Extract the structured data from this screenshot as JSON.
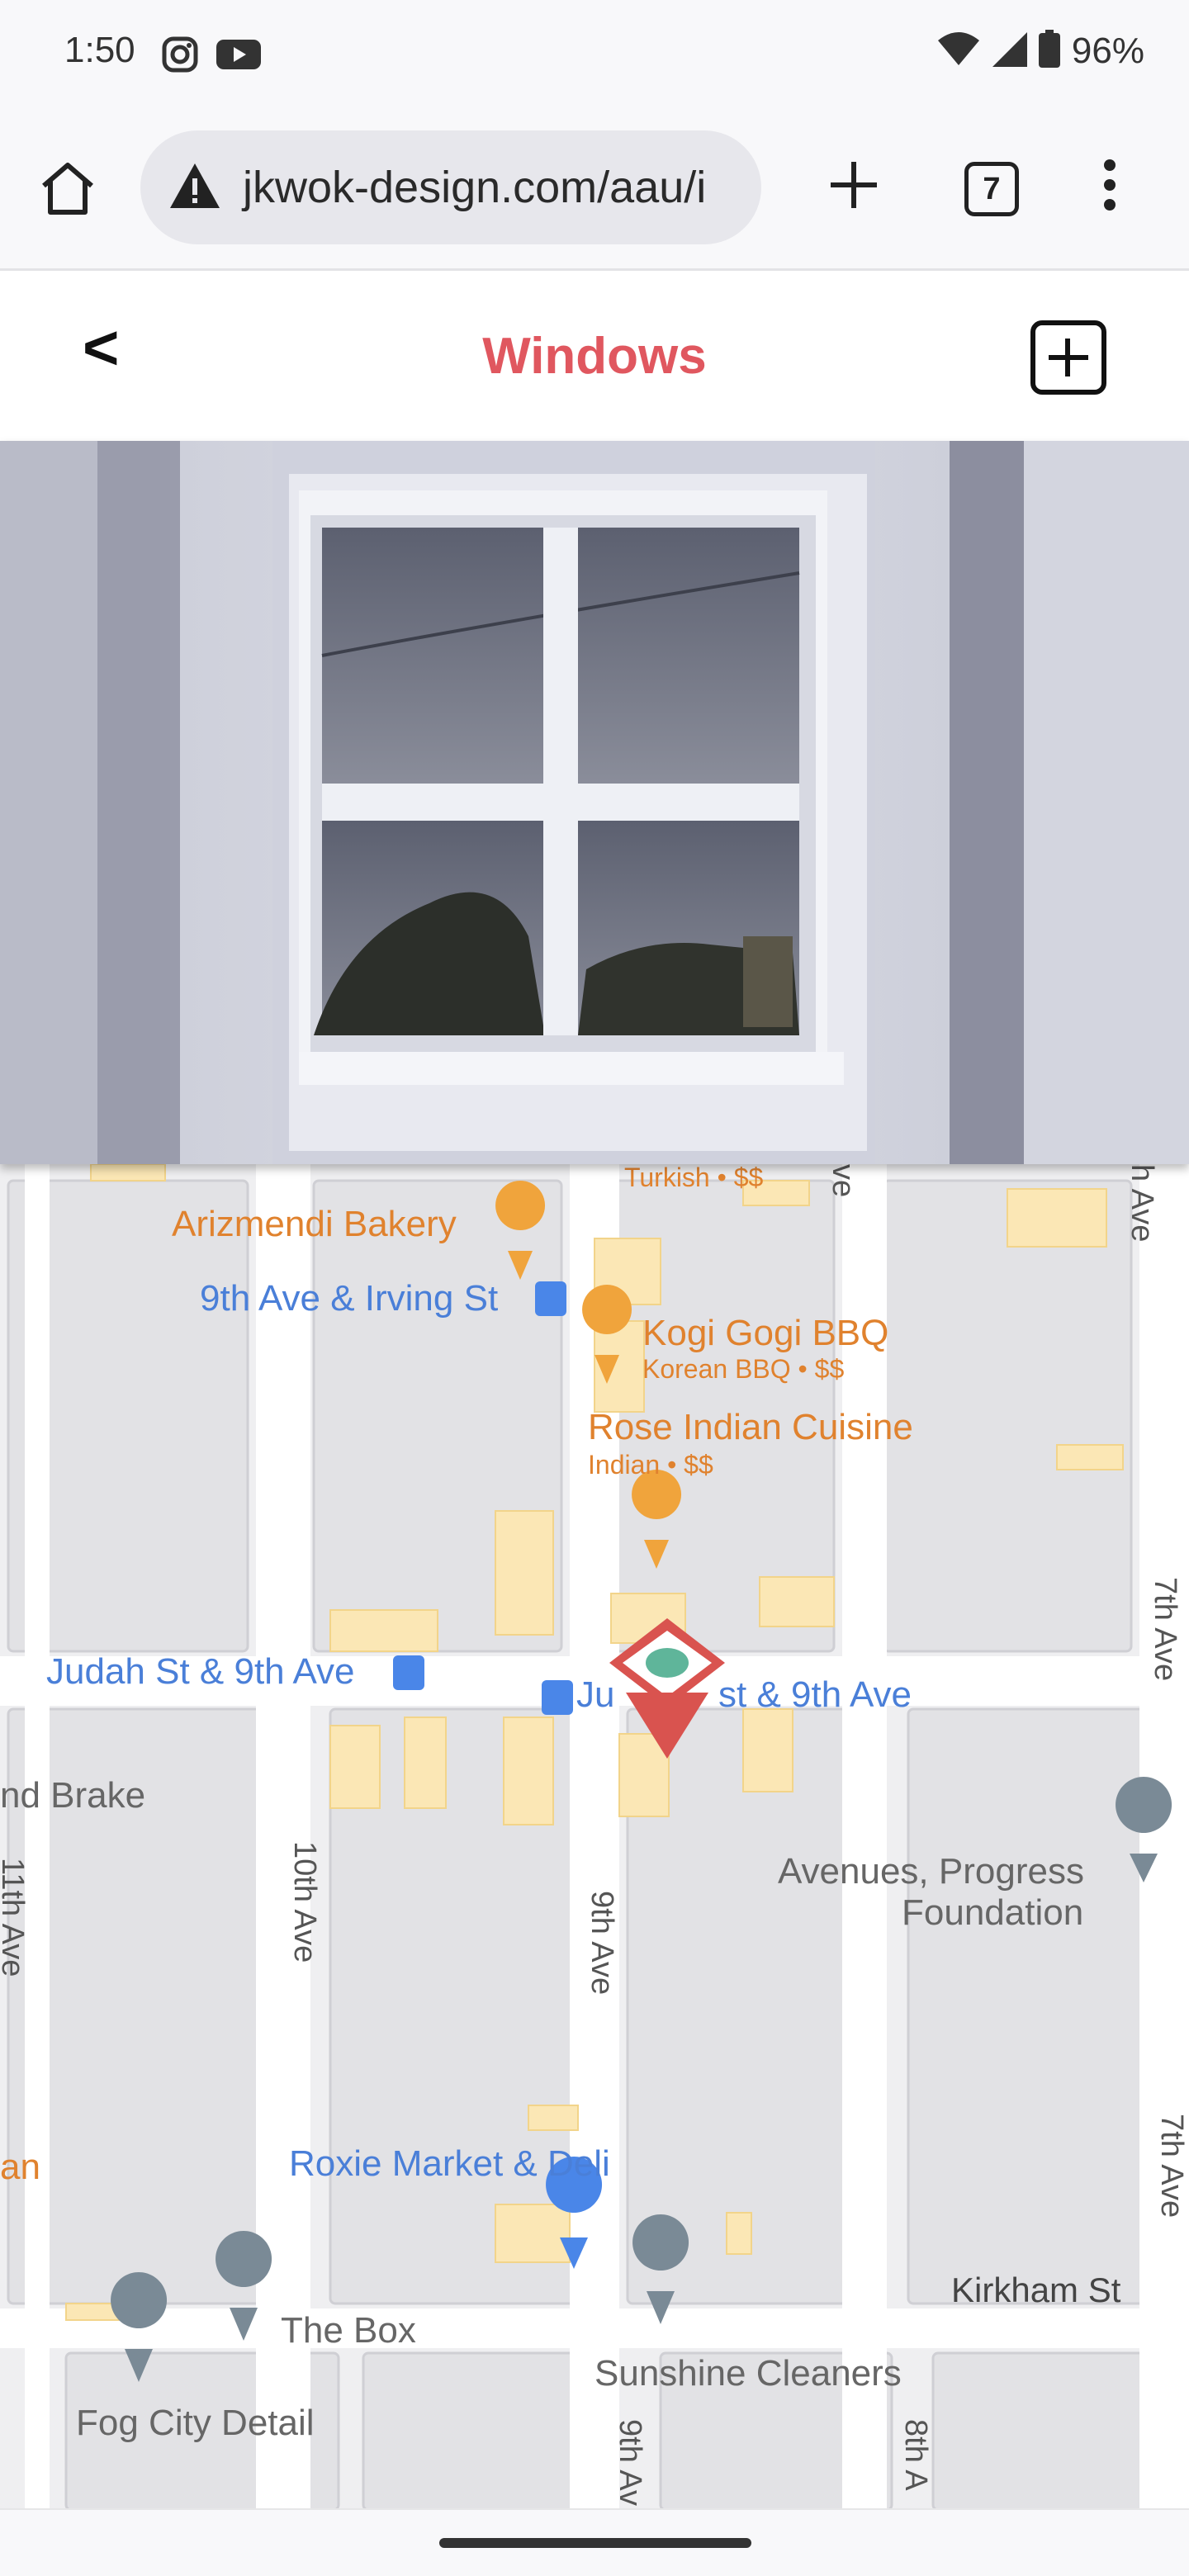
{
  "status_bar": {
    "time": "1:50",
    "battery": "96%",
    "icons": [
      "instagram-icon",
      "youtube-icon",
      "wifi-icon",
      "signal-icon",
      "battery-icon"
    ]
  },
  "browser": {
    "url": "jkwok-design.com/aau/i",
    "tab_count": "7",
    "icons": [
      "home-icon",
      "warning-icon",
      "plus-icon",
      "tabs-icon",
      "more-vert-icon"
    ]
  },
  "header": {
    "back_label": "<",
    "title": "Windows",
    "title_color": "#e0575f"
  },
  "map": {
    "places": {
      "turkish": "Turkish • $$",
      "arizmendi": "Arizmendi Bakery",
      "irving_stop": "9th Ave & Irving St",
      "kogi": "Kogi Gogi BBQ",
      "kogi_sub": "Korean BBQ • $$",
      "rose": "Rose Indian Cuisine",
      "rose_sub": "Indian • $$",
      "judah_stop_w": "Judah St & 9th Ave",
      "judah_stop_e_a": "Ju",
      "judah_stop_e_b": "st & 9th Ave",
      "brake": "nd Brake",
      "avenues_1": "Avenues, Progress",
      "avenues_2": "Foundation",
      "roxie": "Roxie Market & Deli",
      "the_box": "The Box",
      "sunshine": "Sunshine Cleaners",
      "fog_city": "Fog City Detail",
      "an_fragment": "an"
    },
    "streets": {
      "ave_9th_top": "ve",
      "ave_8th_top": "h Ave",
      "ave_7th": "7th Ave",
      "ave_7th_low": "7th Ave",
      "ave_11th": "11th Ave",
      "ave_10th": "10th Ave",
      "ave_9th": "9th Ave",
      "kirkham": "Kirkham St",
      "ave_9th_bottom": "9th Av",
      "ave_8th_bottom": "8th A"
    },
    "marker_colors": {
      "selected": "#d9534f",
      "selected_dot": "#5fb59a",
      "poi_gray": "#7a8a96",
      "food": "#f0a43c",
      "shop": "#4a86e8"
    }
  }
}
